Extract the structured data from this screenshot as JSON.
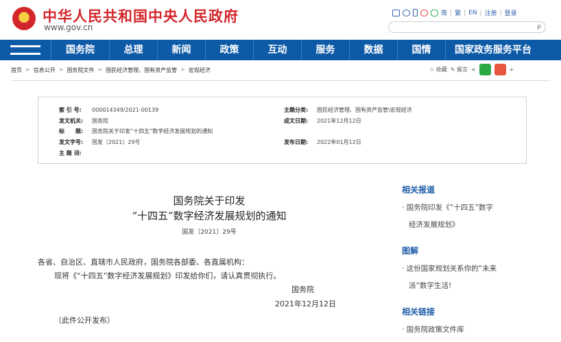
{
  "header": {
    "site_title": "中华人民共和国中央人民政府",
    "site_url": "www.gov.cn",
    "lang_simplified": "简",
    "lang_traditional": "繁",
    "lang_en": "EN",
    "register": "注册",
    "login": "登录",
    "search_icon_glyph": "ρ"
  },
  "nav": {
    "items": [
      "国务院",
      "总理",
      "新闻",
      "政策",
      "互动",
      "服务",
      "数据",
      "国情",
      "国家政务服务平台"
    ]
  },
  "breadcrumb": {
    "items": [
      "首页",
      "信息公开",
      "国务院文件",
      "国民经济管理、国有资产监管",
      "宏观经济"
    ],
    "arrow": ">"
  },
  "share": {
    "favorite": "☆ 收藏",
    "comment": "✎ 留言",
    "share_glyph": "<",
    "plus": "+"
  },
  "info": {
    "index_label": "索 引 号:",
    "index_value": "000014349/2021-00139",
    "category_label": "主题分类:",
    "category_value": "国民经济管理、国有资产监管\\宏观经济",
    "issuer_label": "发文机关:",
    "issuer_value": "国务院",
    "created_label": "成文日期:",
    "created_value": "2021年12月12日",
    "title_label": "标　　题:",
    "title_value": "国务院关于印发“十四五”数字经济发展规划的通知",
    "docno_label": "发文字号:",
    "docno_value": "国发〔2021〕29号",
    "published_label": "发布日期:",
    "published_value": "2022年01月12日",
    "keywords_label": "主 题 词:",
    "keywords_value": ""
  },
  "article": {
    "title_line1": "国务院关于印发",
    "title_line2": "“十四五”数字经济发展规划的通知",
    "doc_no": "国发〔2021〕29号",
    "salutation": "各省、自治区、直辖市人民政府，国务院各部委、各直属机构：",
    "body": "现将《“十四五”数字经济发展规划》印发给你们，请认真贯彻执行。",
    "signature": "国务院",
    "date": "2021年12月12日",
    "note": "（此件公开发布）"
  },
  "sidebar": {
    "related_reports_heading": "相关报道",
    "related_report_line1": "· 国务院印发《“十四五”数字",
    "related_report_line2": "经济发展规划》",
    "illustration_heading": "图解",
    "illustration_line1": "· 这份国家规划关系你的“未来",
    "illustration_line2": "派”数字生活!",
    "links_heading": "相关链接",
    "link_item": "· 国务院政策文件库"
  },
  "colors": {
    "title_red": "#d3262b",
    "nav_blue": "#0d5aa7",
    "sidebar_heading": "#1f5ea8",
    "wechat_green": "#2aa843",
    "weibo_red": "#e8563f"
  }
}
